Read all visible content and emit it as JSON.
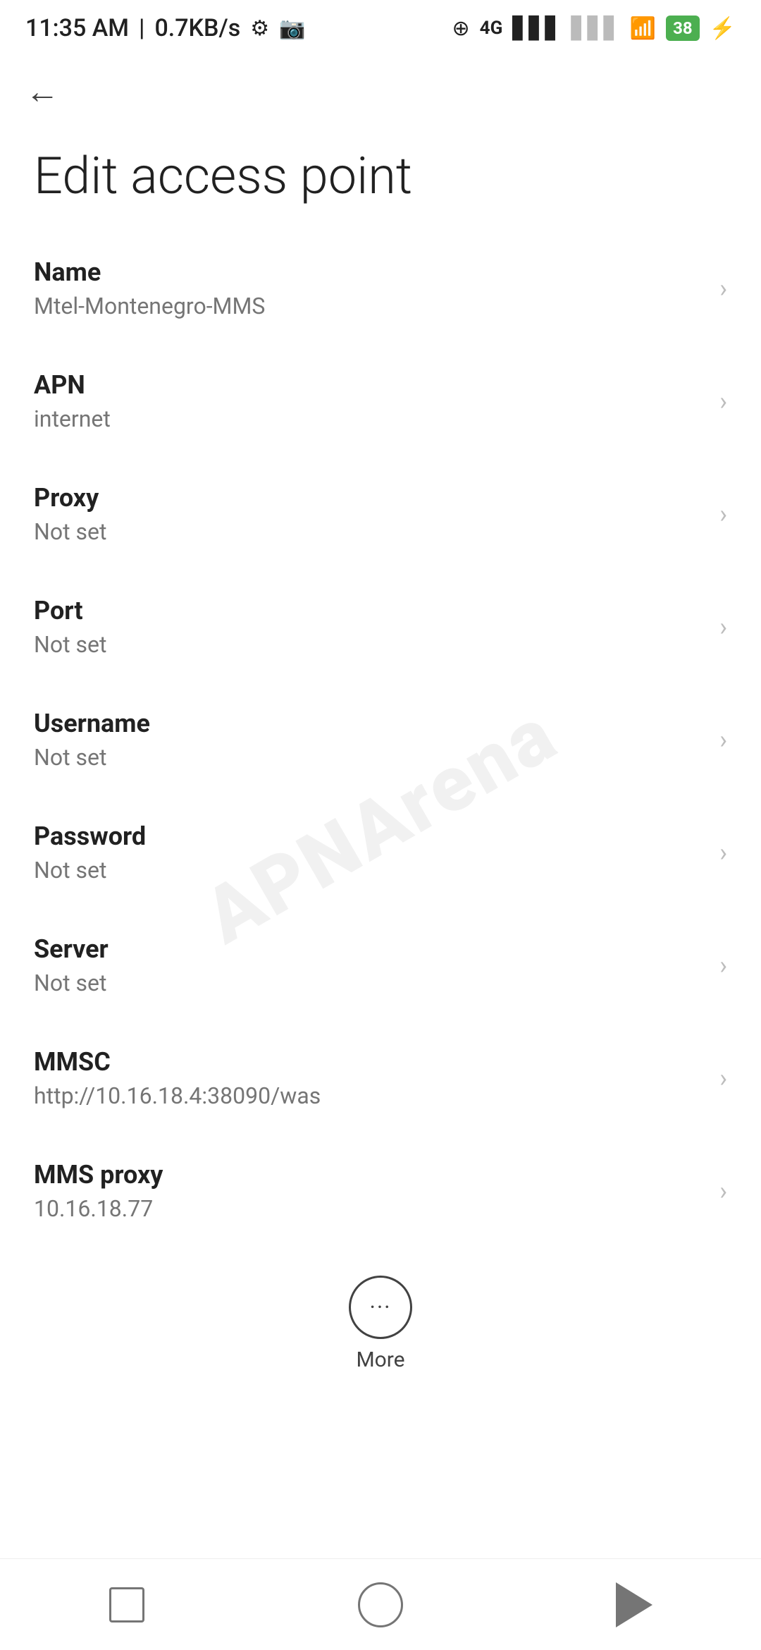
{
  "statusBar": {
    "time": "11:35 AM",
    "speed": "0.7KB/s",
    "batteryPercent": "38"
  },
  "nav": {
    "backLabel": "←"
  },
  "page": {
    "title": "Edit access point"
  },
  "fields": [
    {
      "id": "name",
      "label": "Name",
      "value": "Mtel-Montenegro-MMS"
    },
    {
      "id": "apn",
      "label": "APN",
      "value": "internet"
    },
    {
      "id": "proxy",
      "label": "Proxy",
      "value": "Not set"
    },
    {
      "id": "port",
      "label": "Port",
      "value": "Not set"
    },
    {
      "id": "username",
      "label": "Username",
      "value": "Not set"
    },
    {
      "id": "password",
      "label": "Password",
      "value": "Not set"
    },
    {
      "id": "server",
      "label": "Server",
      "value": "Not set"
    },
    {
      "id": "mmsc",
      "label": "MMSC",
      "value": "http://10.16.18.4:38090/was"
    },
    {
      "id": "mms-proxy",
      "label": "MMS proxy",
      "value": "10.16.18.77"
    }
  ],
  "more": {
    "label": "More",
    "dots": "···"
  },
  "watermark": "APNArena"
}
